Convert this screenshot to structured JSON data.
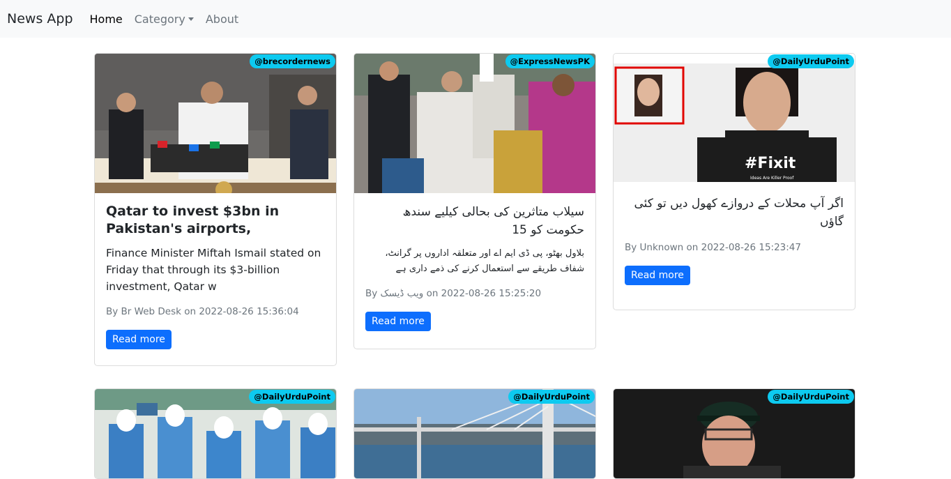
{
  "navbar": {
    "brand": "News App",
    "links": [
      {
        "label": "Home",
        "active": true
      },
      {
        "label": "Category",
        "dropdown": true
      },
      {
        "label": "About"
      }
    ]
  },
  "cards": [
    {
      "source": "@brecordernews",
      "title": "Qatar to invest $3bn in Pakistan's airports,",
      "description": "Finance Minister Miftah Ismail stated on Friday that through its $3-billion investment, Qatar w",
      "meta": "By Br Web Desk on 2022-08-26 15:36:04",
      "button": "Read more"
    },
    {
      "source": "@ExpressNewsPK",
      "title": "سیلاب متاثرین کی بحالی کیلیے سندھ حکومت کو 15",
      "description": "بلاول بھٹو، پی ڈی ایم اے اور متعلقہ اداروں پر گرانٹ، شفاف طریقے سے استعمال کرنے کی ذمے داری ہے",
      "meta_prefix": "By ",
      "meta_author": "ویب ڈیسک",
      "meta_suffix": " on 2022-08-26 15:25:20",
      "button": "Read more"
    },
    {
      "source": "@DailyUrduPoint",
      "title": "اگر آپ محلات کے دروازے کھول دیں تو کئی گاؤں",
      "meta": "By Unknown on 2022-08-26 15:23:47",
      "button": "Read more",
      "image_text": "#Fixit",
      "image_subtext": "Ideas Are Killer Proof"
    },
    {
      "source": "@DailyUrduPoint"
    },
    {
      "source": "@DailyUrduPoint"
    },
    {
      "source": "@DailyUrduPoint"
    }
  ]
}
